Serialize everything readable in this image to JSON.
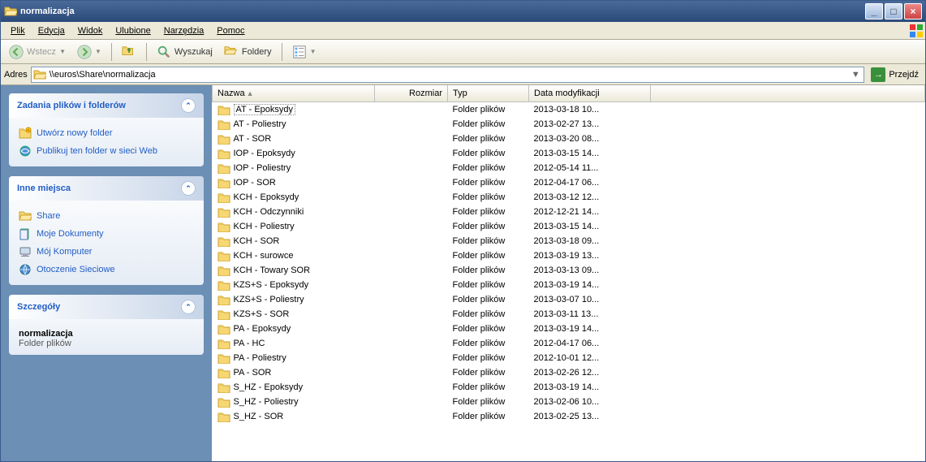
{
  "window": {
    "title": "normalizacja"
  },
  "menu": {
    "file": "Plik",
    "edit": "Edycja",
    "view": "Widok",
    "favorites": "Ulubione",
    "tools": "Narzędzia",
    "help": "Pomoc"
  },
  "toolbar": {
    "back": "Wstecz",
    "search": "Wyszukaj",
    "folders": "Foldery"
  },
  "address": {
    "label": "Adres",
    "path": "\\\\euros\\Share\\normalizacja",
    "go": "Przejdź"
  },
  "sidebar": {
    "tasks": {
      "title": "Zadania plików i folderów",
      "items": [
        {
          "icon": "newfolder",
          "label": "Utwórz nowy folder"
        },
        {
          "icon": "publish",
          "label": "Publikuj ten folder w sieci Web"
        }
      ]
    },
    "places": {
      "title": "Inne miejsca",
      "items": [
        {
          "icon": "share",
          "label": "Share"
        },
        {
          "icon": "mydocs",
          "label": "Moje Dokumenty"
        },
        {
          "icon": "mycomp",
          "label": "Mój Komputer"
        },
        {
          "icon": "network",
          "label": "Otoczenie Sieciowe"
        }
      ]
    },
    "details": {
      "title": "Szczegóły",
      "name": "normalizacja",
      "type": "Folder plików"
    }
  },
  "columns": {
    "name": "Nazwa",
    "size": "Rozmiar",
    "type": "Typ",
    "modified": "Data modyfikacji"
  },
  "type_label": "Folder plików",
  "files": [
    {
      "name": "AT - Epoksydy",
      "modified": "2013-03-18 10...",
      "selected": true
    },
    {
      "name": "AT - Poliestry",
      "modified": "2013-02-27 13..."
    },
    {
      "name": "AT - SOR",
      "modified": "2013-03-20 08..."
    },
    {
      "name": "IOP - Epoksydy",
      "modified": "2013-03-15 14..."
    },
    {
      "name": "IOP - Poliestry",
      "modified": "2012-05-14 11..."
    },
    {
      "name": "IOP - SOR",
      "modified": "2012-04-17 06..."
    },
    {
      "name": "KCH - Epoksydy",
      "modified": "2013-03-12 12..."
    },
    {
      "name": "KCH - Odczynniki",
      "modified": "2012-12-21 14..."
    },
    {
      "name": "KCH - Poliestry",
      "modified": "2013-03-15 14..."
    },
    {
      "name": "KCH - SOR",
      "modified": "2013-03-18 09..."
    },
    {
      "name": "KCH - surowce",
      "modified": "2013-03-19 13..."
    },
    {
      "name": "KCH - Towary SOR",
      "modified": "2013-03-13 09..."
    },
    {
      "name": "KZS+S - Epoksydy",
      "modified": "2013-03-19 14..."
    },
    {
      "name": "KZS+S - Poliestry",
      "modified": "2013-03-07 10..."
    },
    {
      "name": "KZS+S - SOR",
      "modified": "2013-03-11 13..."
    },
    {
      "name": "PA - Epoksydy",
      "modified": "2013-03-19 14..."
    },
    {
      "name": "PA - HC",
      "modified": "2012-04-17 06..."
    },
    {
      "name": "PA - Poliestry",
      "modified": "2012-10-01 12..."
    },
    {
      "name": "PA - SOR",
      "modified": "2013-02-26 12..."
    },
    {
      "name": "S_HZ - Epoksydy",
      "modified": "2013-03-19 14..."
    },
    {
      "name": "S_HZ - Poliestry",
      "modified": "2013-02-06 10..."
    },
    {
      "name": "S_HZ - SOR",
      "modified": "2013-02-25 13..."
    }
  ]
}
